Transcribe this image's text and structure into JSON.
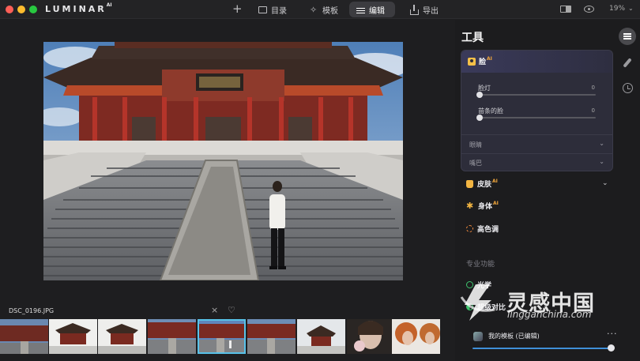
{
  "app": {
    "brand": "LUMINAR",
    "brand_sup": "AI"
  },
  "toolbar": {
    "add_icon": "plus",
    "catalog_label": "目录",
    "templates_label": "模板",
    "edit_label": "编辑",
    "export_label": "导出",
    "zoom_value": "19%"
  },
  "filmstrip": {
    "file_name": "DSC_0196.JPG",
    "close_icon": "×",
    "heart_icon": "♡",
    "selected_index": 4,
    "thumb_count": 9
  },
  "panel": {
    "title": "工具",
    "face": {
      "label": "脸",
      "ai_badge": "AI",
      "sliders": [
        {
          "label": "脸灯",
          "value": "0"
        },
        {
          "label": "苗条的脸",
          "value": "0"
        }
      ],
      "sub_sections": [
        {
          "label": "眼睛"
        },
        {
          "label": "嘴巴"
        }
      ]
    },
    "tools": [
      {
        "label": "皮肤",
        "ai_badge": "AI"
      },
      {
        "label": "身体",
        "ai_badge": "AI"
      },
      {
        "label": "高色调",
        "ai_badge": ""
      }
    ],
    "pro_section_label": "专业功能",
    "pro_tools": [
      {
        "label": "光学"
      },
      {
        "label": "超级对比"
      }
    ],
    "preset": {
      "name": "我的模板 (已编辑)",
      "more": "···",
      "amount": 1.0
    }
  },
  "watermark": {
    "text": "灵感中国",
    "sub": "lingganchina.com"
  },
  "colors": {
    "accent": "#58c2e9",
    "ai_badge": "#f0a63c",
    "tool_icon": "#f2b542",
    "pro_icon": "#3ec46d"
  }
}
